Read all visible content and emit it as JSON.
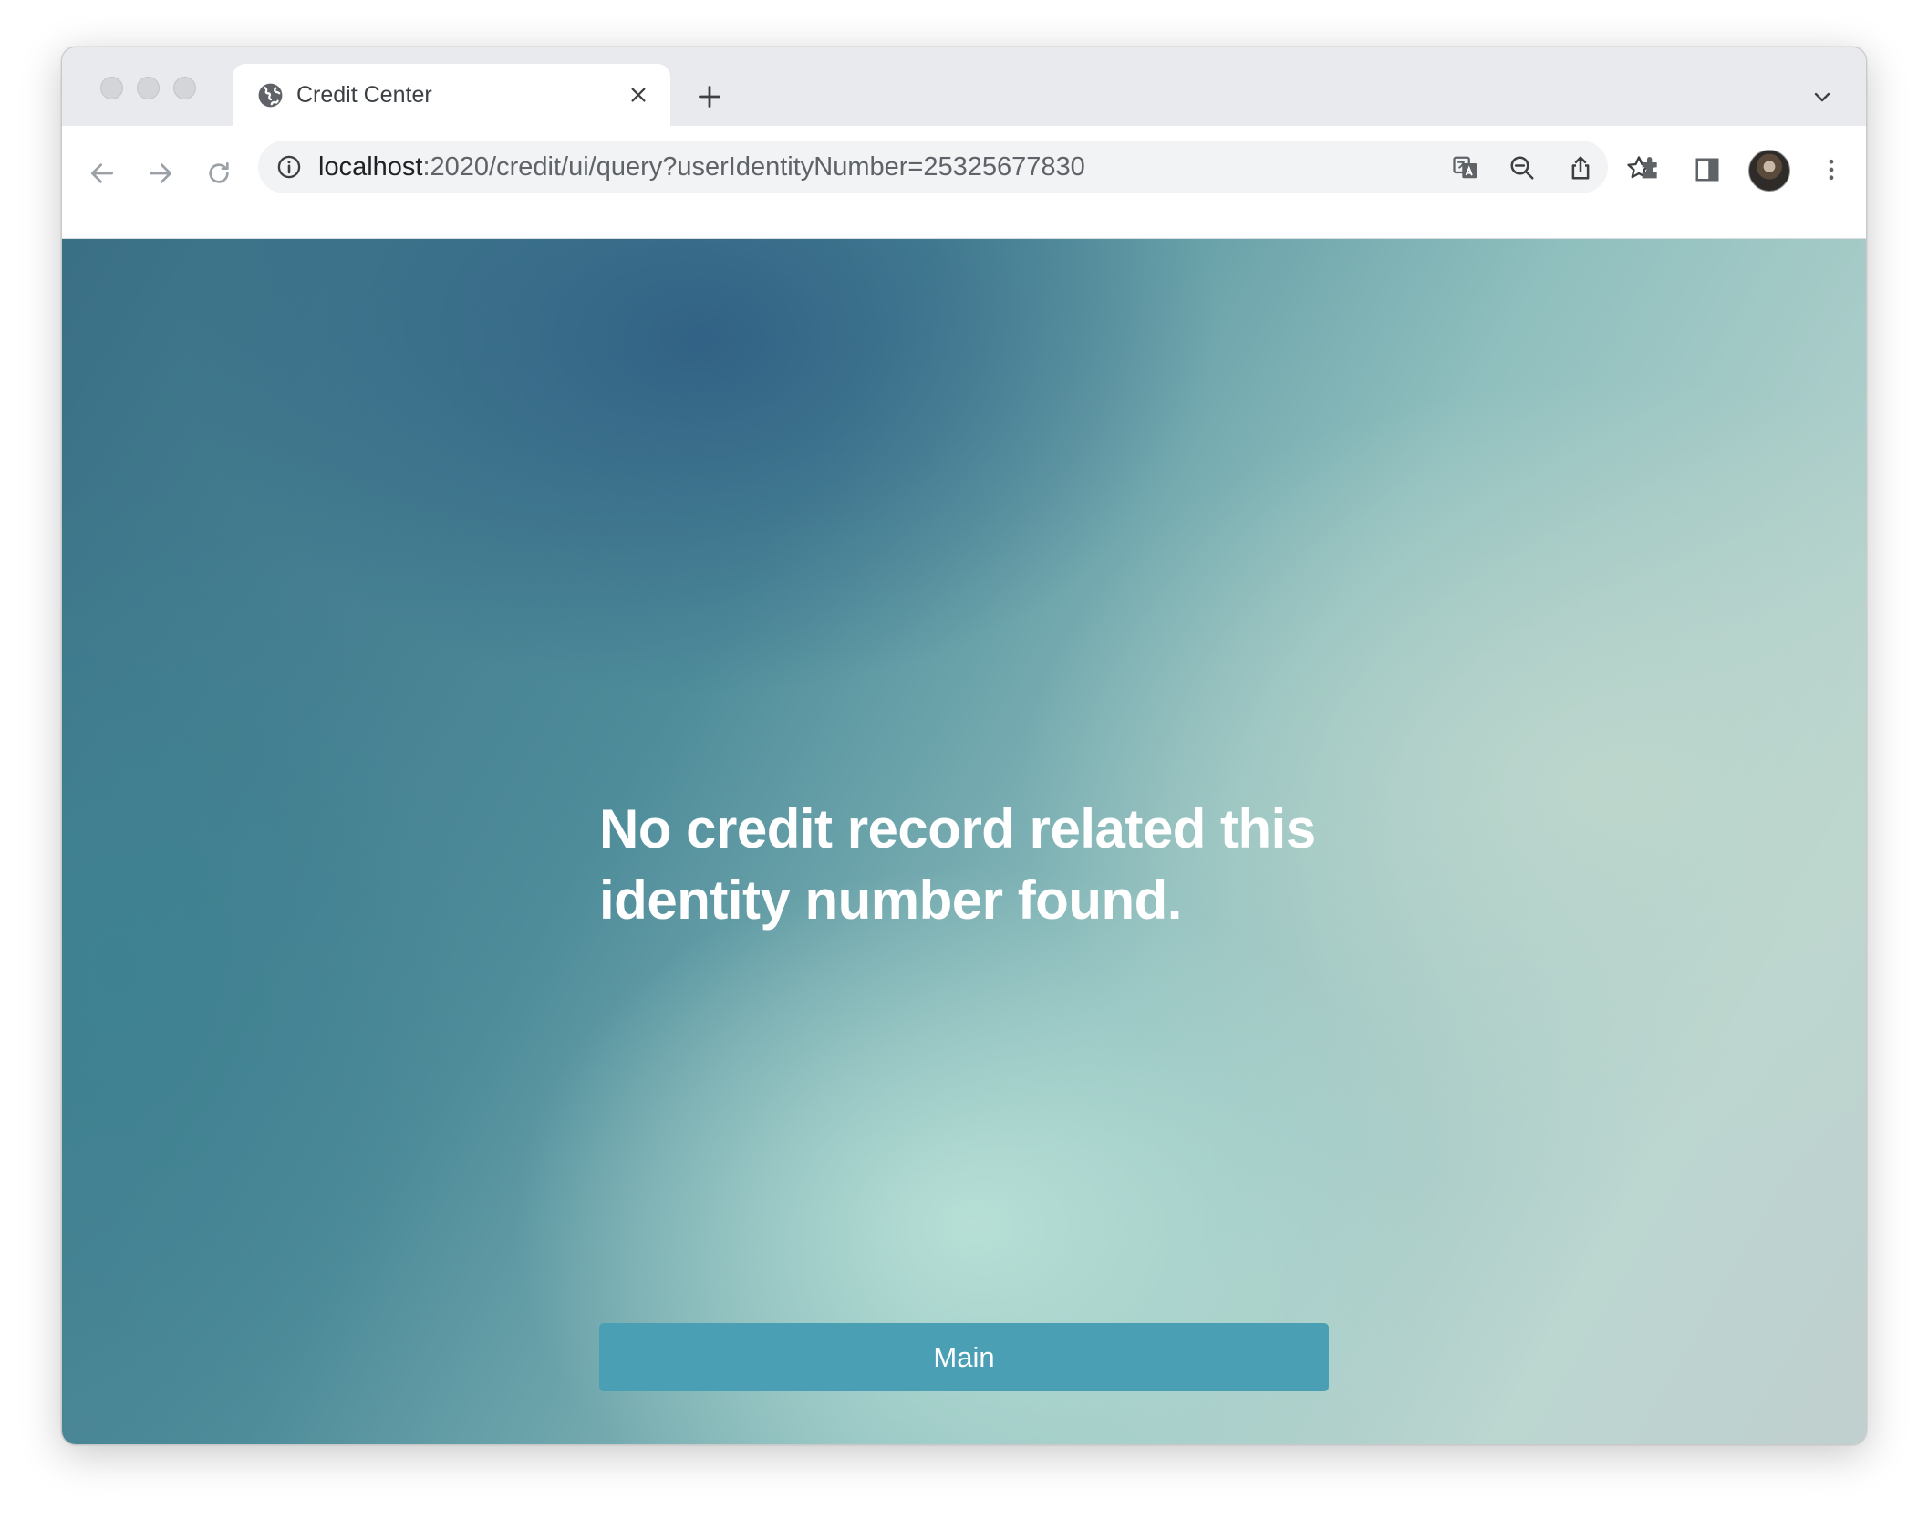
{
  "browser": {
    "tab": {
      "title": "Credit Center"
    },
    "address_bar": {
      "host": "localhost",
      "path": ":2020/credit/ui/query?userIdentityNumber=25325677830"
    },
    "icons": [
      "globe-icon",
      "close-icon",
      "plus-icon",
      "chevron-down-icon",
      "back-arrow-icon",
      "forward-arrow-icon",
      "reload-icon",
      "info-icon",
      "translate-icon",
      "zoom-out-icon",
      "share-icon",
      "star-icon",
      "puzzle-icon",
      "side-panel-icon",
      "avatar",
      "more-vert-icon"
    ]
  },
  "page": {
    "message": "No credit record related this identity number found.",
    "main_button_label": "Main",
    "colors": {
      "button": "#4a9fb4",
      "text": "#ffffff"
    }
  }
}
